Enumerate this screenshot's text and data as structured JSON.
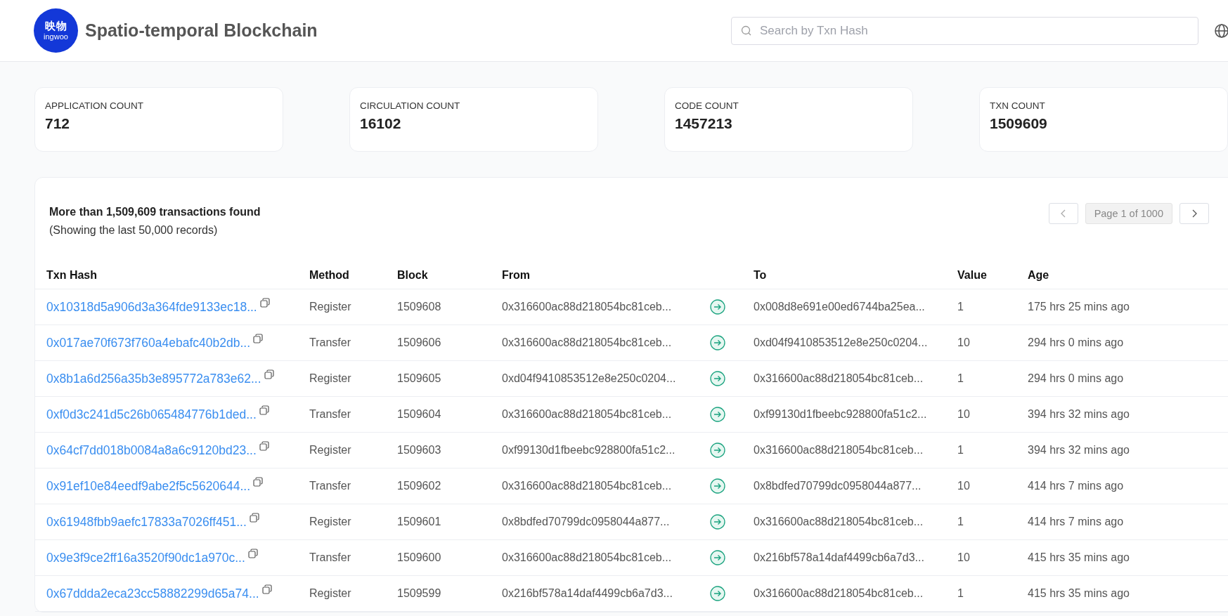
{
  "header": {
    "logo": {
      "line_1": "映物",
      "line_2": "ingwoo"
    },
    "title": "Spatio-temporal Blockchain",
    "search": {
      "placeholder": "Search by Txn Hash"
    }
  },
  "stats": [
    {
      "label": "APPLICATION COUNT",
      "value": "712"
    },
    {
      "label": "CIRCULATION COUNT",
      "value": "16102"
    },
    {
      "label": "CODE COUNT",
      "value": "1457213"
    },
    {
      "label": "TXN COUNT",
      "value": "1509609"
    }
  ],
  "transactions": {
    "summary": "More than 1,509,609 transactions found",
    "note": "(Showing the last 50,000 records)",
    "pagination": {
      "page": "Page 1 of 1000"
    },
    "columns": [
      "Txn Hash",
      "Method",
      "Block",
      "From",
      "To",
      "Value",
      "Age"
    ],
    "rows": [
      {
        "hash": "0x10318d5a906d3a364fde9133ec18...",
        "method": "Register",
        "block": "1509608",
        "from": "0x316600ac88d218054bc81ceb...",
        "to": "0x008d8e691e00ed6744ba25ea...",
        "value": "1",
        "age": "175 hrs 25 mins ago"
      },
      {
        "hash": "0x017ae70f673f760a4ebafc40b2db...",
        "method": "Transfer",
        "block": "1509606",
        "from": "0x316600ac88d218054bc81ceb...",
        "to": "0xd04f9410853512e8e250c0204...",
        "value": "10",
        "age": "294 hrs 0 mins ago"
      },
      {
        "hash": "0x8b1a6d256a35b3e895772a783e62...",
        "method": "Register",
        "block": "1509605",
        "from": "0xd04f9410853512e8e250c0204...",
        "to": "0x316600ac88d218054bc81ceb...",
        "value": "1",
        "age": "294 hrs 0 mins ago"
      },
      {
        "hash": "0xf0d3c241d5c26b065484776b1ded...",
        "method": "Transfer",
        "block": "1509604",
        "from": "0x316600ac88d218054bc81ceb...",
        "to": "0xf99130d1fbeebc928800fa51c2...",
        "value": "10",
        "age": "394 hrs 32 mins ago"
      },
      {
        "hash": "0x64cf7dd018b0084a8a6c9120bd23...",
        "method": "Register",
        "block": "1509603",
        "from": "0xf99130d1fbeebc928800fa51c2...",
        "to": "0x316600ac88d218054bc81ceb...",
        "value": "1",
        "age": "394 hrs 32 mins ago"
      },
      {
        "hash": "0x91ef10e84eedf9abe2f5c5620644...",
        "method": "Transfer",
        "block": "1509602",
        "from": "0x316600ac88d218054bc81ceb...",
        "to": "0x8bdfed70799dc0958044a877...",
        "value": "10",
        "age": "414 hrs 7 mins ago"
      },
      {
        "hash": "0x61948fbb9aefc17833a7026ff451...",
        "method": "Register",
        "block": "1509601",
        "from": "0x8bdfed70799dc0958044a877...",
        "to": "0x316600ac88d218054bc81ceb...",
        "value": "1",
        "age": "414 hrs 7 mins ago"
      },
      {
        "hash": "0x9e3f9ce2ff16a3520f90dc1a970c...",
        "method": "Transfer",
        "block": "1509600",
        "from": "0x316600ac88d218054bc81ceb...",
        "to": "0x216bf578a14daf4499cb6a7d3...",
        "value": "10",
        "age": "415 hrs 35 mins ago"
      },
      {
        "hash": "0x67ddda2eca23cc58882299d65a74...",
        "method": "Register",
        "block": "1509599",
        "from": "0x216bf578a14daf4499cb6a7d3...",
        "to": "0x316600ac88d218054bc81ceb...",
        "value": "1",
        "age": "415 hrs 35 mins ago"
      }
    ]
  }
}
